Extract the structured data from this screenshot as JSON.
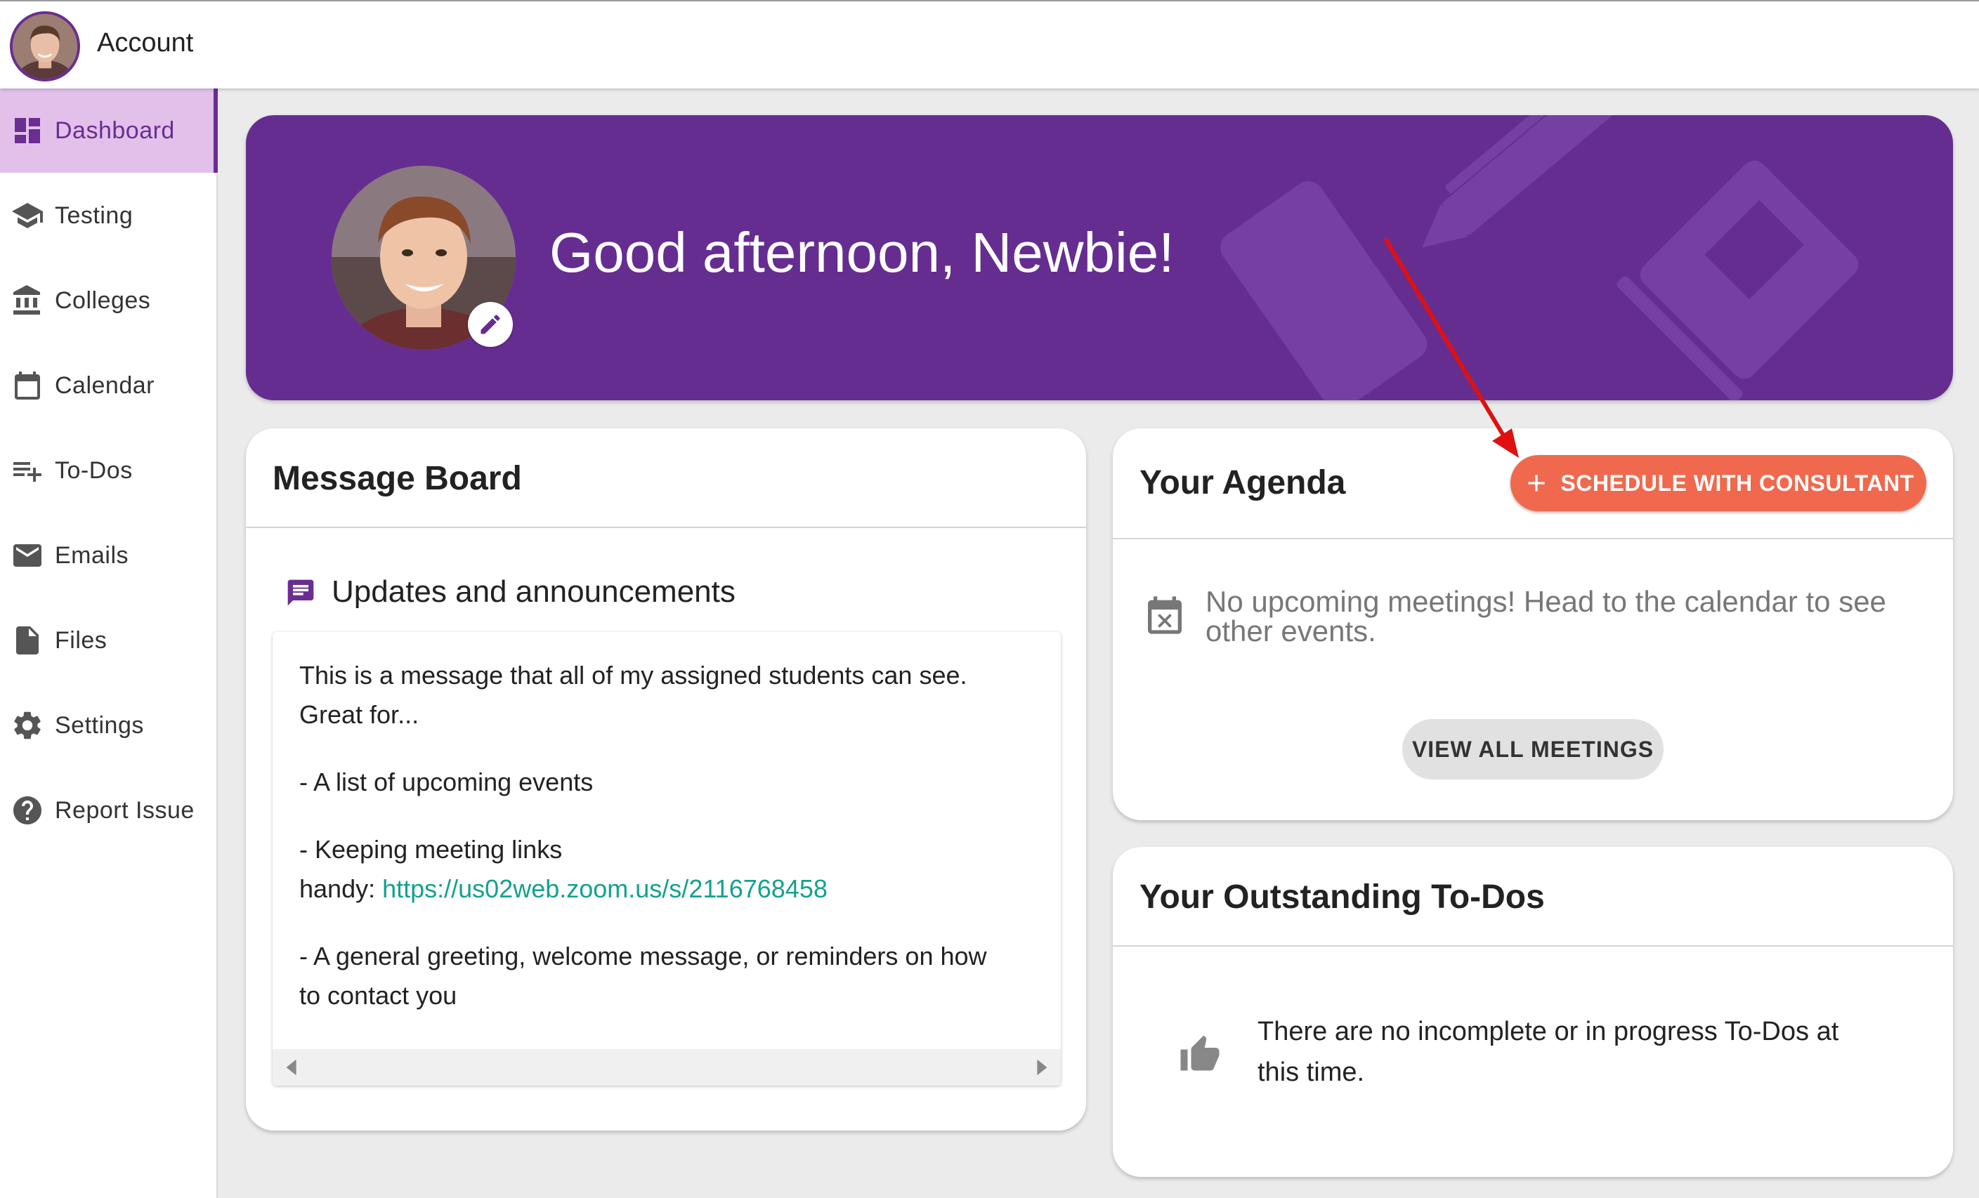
{
  "topbar": {
    "account_label": "Account"
  },
  "sidebar": {
    "items": [
      {
        "label": "Dashboard",
        "icon": "dashboard-icon",
        "active": true
      },
      {
        "label": "Testing",
        "icon": "graduation-cap-icon"
      },
      {
        "label": "Colleges",
        "icon": "institution-icon"
      },
      {
        "label": "Calendar",
        "icon": "calendar-icon"
      },
      {
        "label": "To-Dos",
        "icon": "playlist-add-icon"
      },
      {
        "label": "Emails",
        "icon": "mail-icon"
      },
      {
        "label": "Files",
        "icon": "file-icon"
      },
      {
        "label": "Settings",
        "icon": "gear-icon"
      },
      {
        "label": "Report Issue",
        "icon": "help-icon"
      }
    ]
  },
  "hero": {
    "greeting": "Good afternoon, Newbie!"
  },
  "message_board": {
    "title": "Message Board",
    "section_title": "Updates and announcements",
    "lines": [
      "This is a message that all of my assigned students can see.",
      "Great for...",
      "- A list of upcoming events",
      "- Keeping meeting links",
      "handy: ",
      "- A general greeting, welcome message, or reminders on how",
      "to contact you"
    ],
    "link": "https://us02web.zoom.us/s/2116768458"
  },
  "agenda": {
    "title": "Your Agenda",
    "schedule_button": "SCHEDULE WITH CONSULTANT",
    "empty_text": "No upcoming meetings! Head to the calendar to see other events.",
    "view_all_button": "VIEW ALL MEETINGS"
  },
  "todos": {
    "title": "Your Outstanding To-Dos",
    "empty_line1": "There are no incomplete or in progress To-Dos at",
    "empty_line2": "this time."
  },
  "colors": {
    "brand_purple": "#662d91",
    "active_nav_bg": "#e3c0ea",
    "accent_orange": "#f0684d",
    "link_teal": "#13a18f",
    "annotation_red": "#e01010"
  }
}
